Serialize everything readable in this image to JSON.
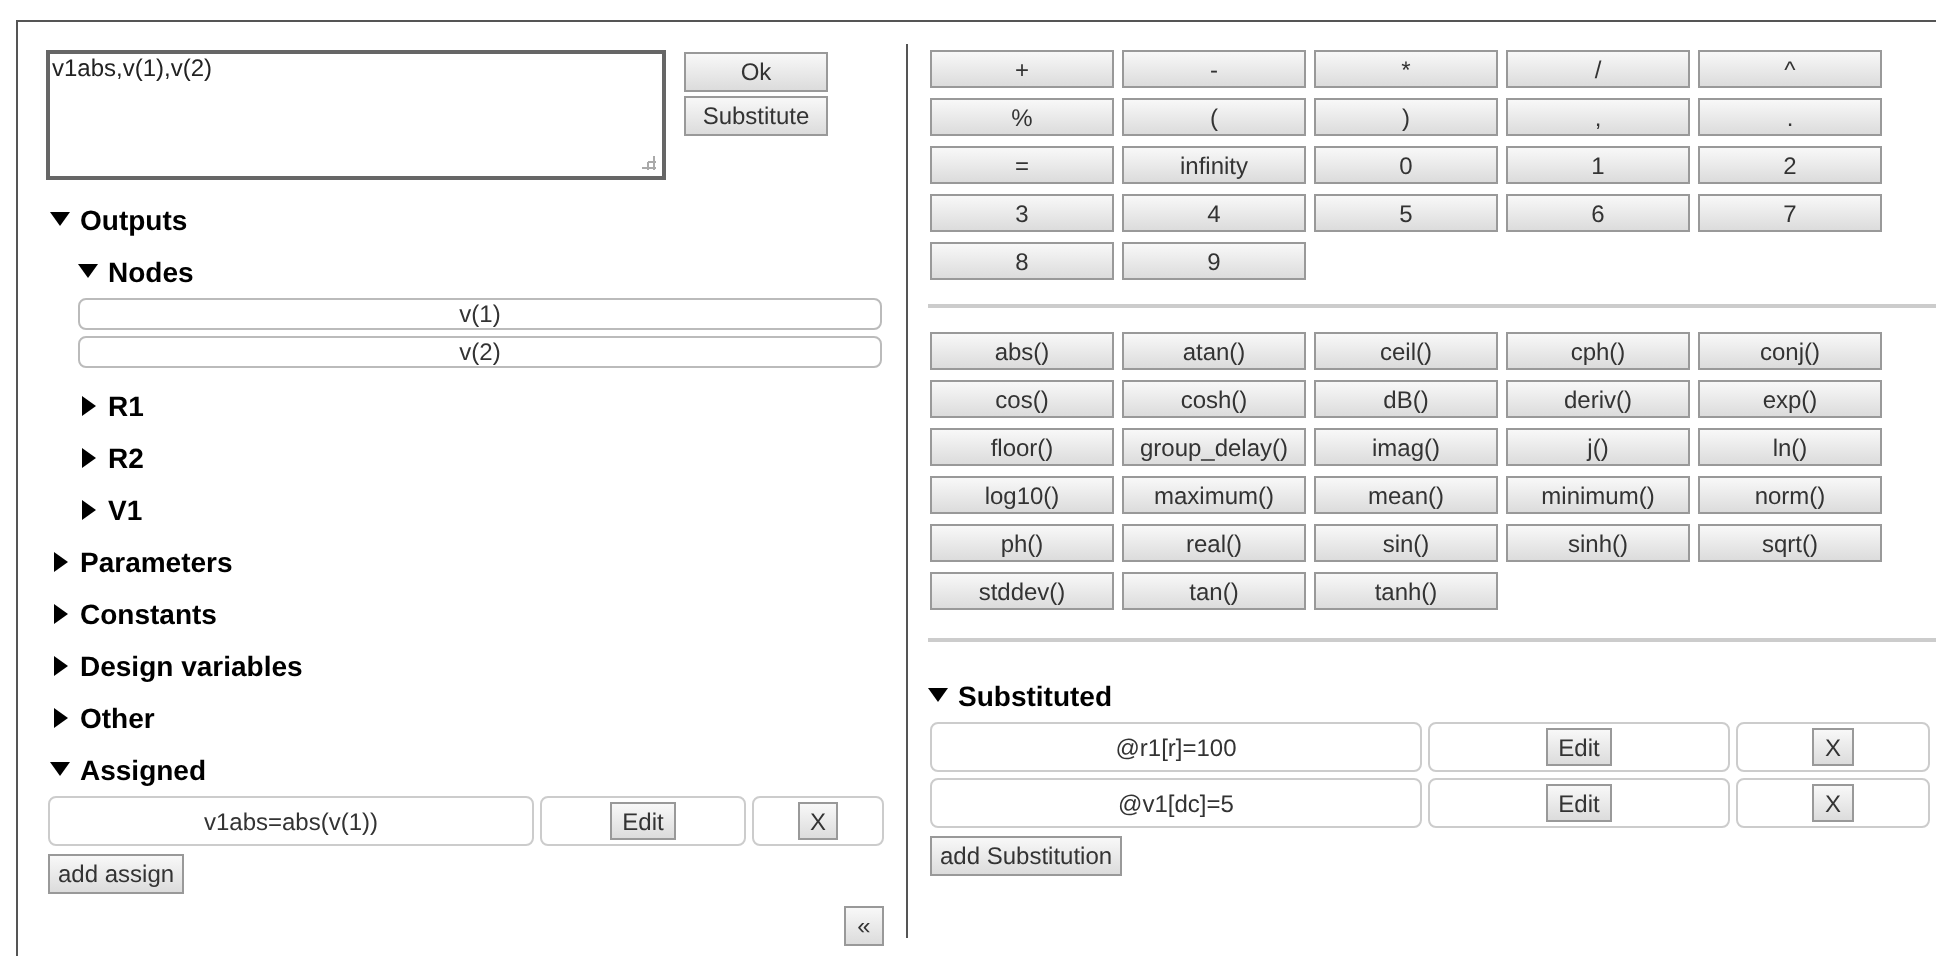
{
  "expression": {
    "value": "v1abs,v(1),v(2)"
  },
  "actions": [
    "Ok",
    "Substitute"
  ],
  "tree": [
    {
      "label": "Outputs",
      "expanded": true,
      "children": [
        {
          "label": "Nodes",
          "expanded": true,
          "items": [
            "v(1)",
            "v(2)"
          ]
        },
        {
          "label": "R1",
          "expanded": false
        },
        {
          "label": "R2",
          "expanded": false
        },
        {
          "label": "V1",
          "expanded": false
        }
      ]
    },
    {
      "label": "Parameters",
      "expanded": false
    },
    {
      "label": "Constants",
      "expanded": false
    },
    {
      "label": "Design variables",
      "expanded": false
    },
    {
      "label": "Other",
      "expanded": false
    }
  ],
  "assigned": {
    "label": "Assigned",
    "expanded": true,
    "rows": [
      {
        "expression": "v1abs=abs(v(1))",
        "edit": "Edit",
        "remove": "X"
      }
    ],
    "add_button": "add assign"
  },
  "collapse_button": "«",
  "operators": [
    "+",
    "-",
    "*",
    "/",
    "^",
    "%",
    "(",
    ")",
    ",",
    ".",
    "=",
    "infinity",
    "0",
    "1",
    "2",
    "3",
    "4",
    "5",
    "6",
    "7",
    "8",
    "9"
  ],
  "functions": [
    "abs()",
    "atan()",
    "ceil()",
    "cph()",
    "conj()",
    "cos()",
    "cosh()",
    "dB()",
    "deriv()",
    "exp()",
    "floor()",
    "group_delay()",
    "imag()",
    "j()",
    "ln()",
    "log10()",
    "maximum()",
    "mean()",
    "minimum()",
    "norm()",
    "ph()",
    "real()",
    "sin()",
    "sinh()",
    "sqrt()",
    "stddev()",
    "tan()",
    "tanh()"
  ],
  "substituted": {
    "label": "Substituted",
    "expanded": true,
    "rows": [
      {
        "expression": "@r1[r]=100",
        "edit": "Edit",
        "remove": "X"
      },
      {
        "expression": "@v1[dc]=5",
        "edit": "Edit",
        "remove": "X"
      }
    ],
    "add_button": "add Substitution"
  }
}
